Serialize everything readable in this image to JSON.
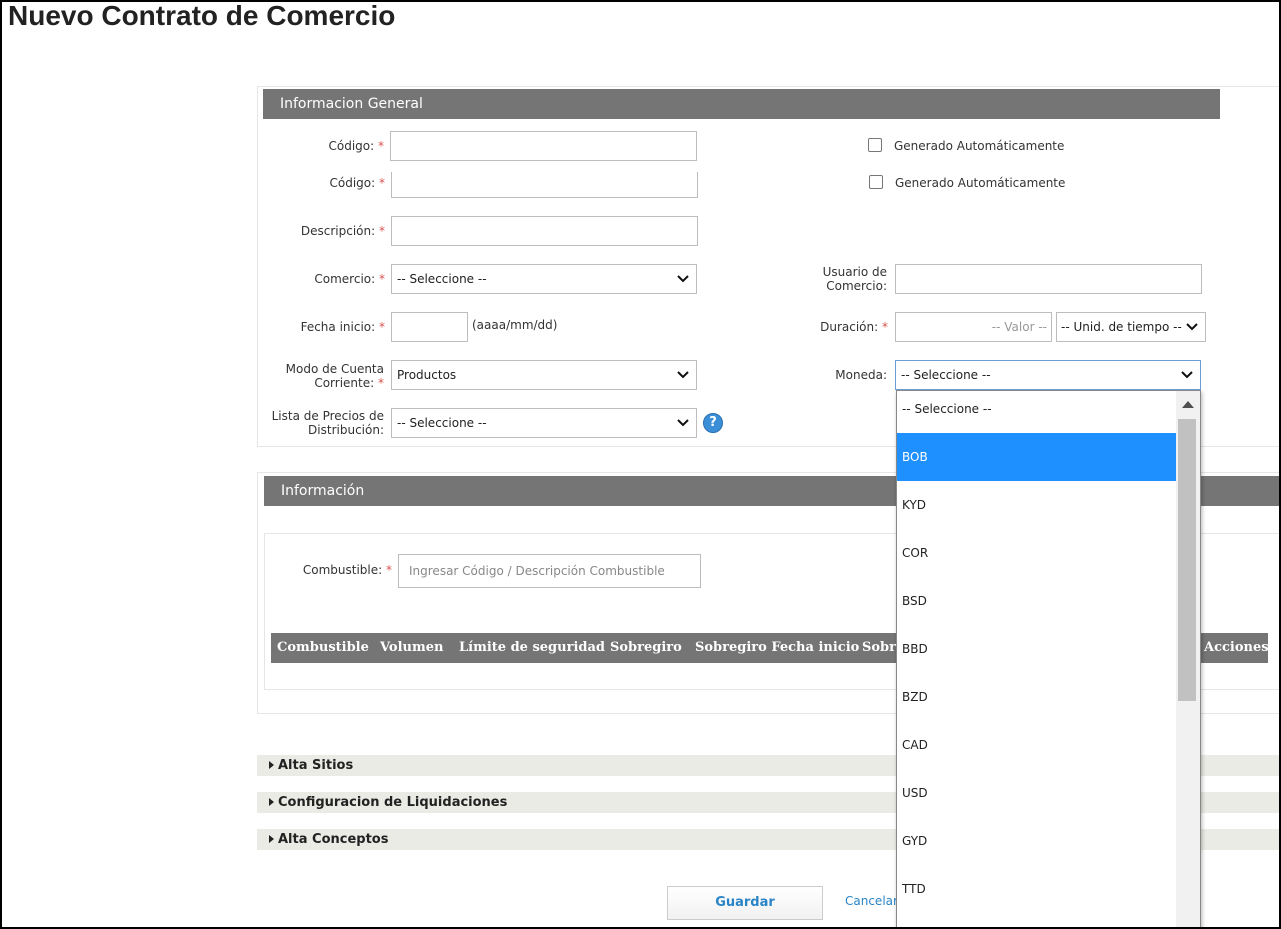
{
  "page": {
    "title": "Nuevo Contrato de Comercio"
  },
  "general": {
    "header": "Informacion General",
    "codigo_label": "Código:",
    "codigo2_label": "Código:",
    "auto_label": "Generado Automáticamente",
    "auto2_label": "Generado Automáticamente",
    "descripcion_label": "Descripción:",
    "comercio_label": "Comercio:",
    "comercio_value": "-- Seleccione --",
    "usuario_label_1": "Usuario de",
    "usuario_label_2": "Comercio:",
    "fecha_label": "Fecha inicio:",
    "fecha_hint": "(aaaa/mm/dd)",
    "duracion_label": "Duración:",
    "duracion_placeholder": "-- Valor --",
    "unidad_value": "-- Unid. de tiempo --",
    "modo_label_1": "Modo de Cuenta",
    "modo_label_2": "Corriente:",
    "modo_value": "Productos",
    "moneda_label": "Moneda:",
    "moneda_value": "-- Seleccione --",
    "lista_label_1": "Lista de Precios de",
    "lista_label_2": "Distribución:",
    "lista_value": "-- Seleccione --",
    "required_mark": "*",
    "help_glyph": "?"
  },
  "informacion": {
    "header": "Información",
    "combustible_label": "Combustible:",
    "combustible_placeholder": "Ingresar Código / Descripción Combustible",
    "columns": [
      "Combustible",
      "Volumen",
      "Límite de seguridad",
      "Sobregiro",
      "Sobregiro Fecha inicio",
      "Sobre",
      "Acciones"
    ]
  },
  "accordions": [
    "Alta Sitios",
    "Configuracion de Liquidaciones",
    "Alta Conceptos"
  ],
  "actions": {
    "save": "Guardar",
    "cancel": "Cancelar"
  },
  "currency_dropdown": {
    "options": [
      "-- Seleccione --",
      "BOB",
      "KYD",
      "COR",
      "BSD",
      "BBD",
      "BZD",
      "CAD",
      "USD",
      "GYD",
      "TTD"
    ],
    "highlighted": "BOB"
  },
  "colors": {
    "section_header": "#757575",
    "link": "#2a84c6",
    "highlight": "#1e90ff",
    "required": "#d9534f"
  }
}
